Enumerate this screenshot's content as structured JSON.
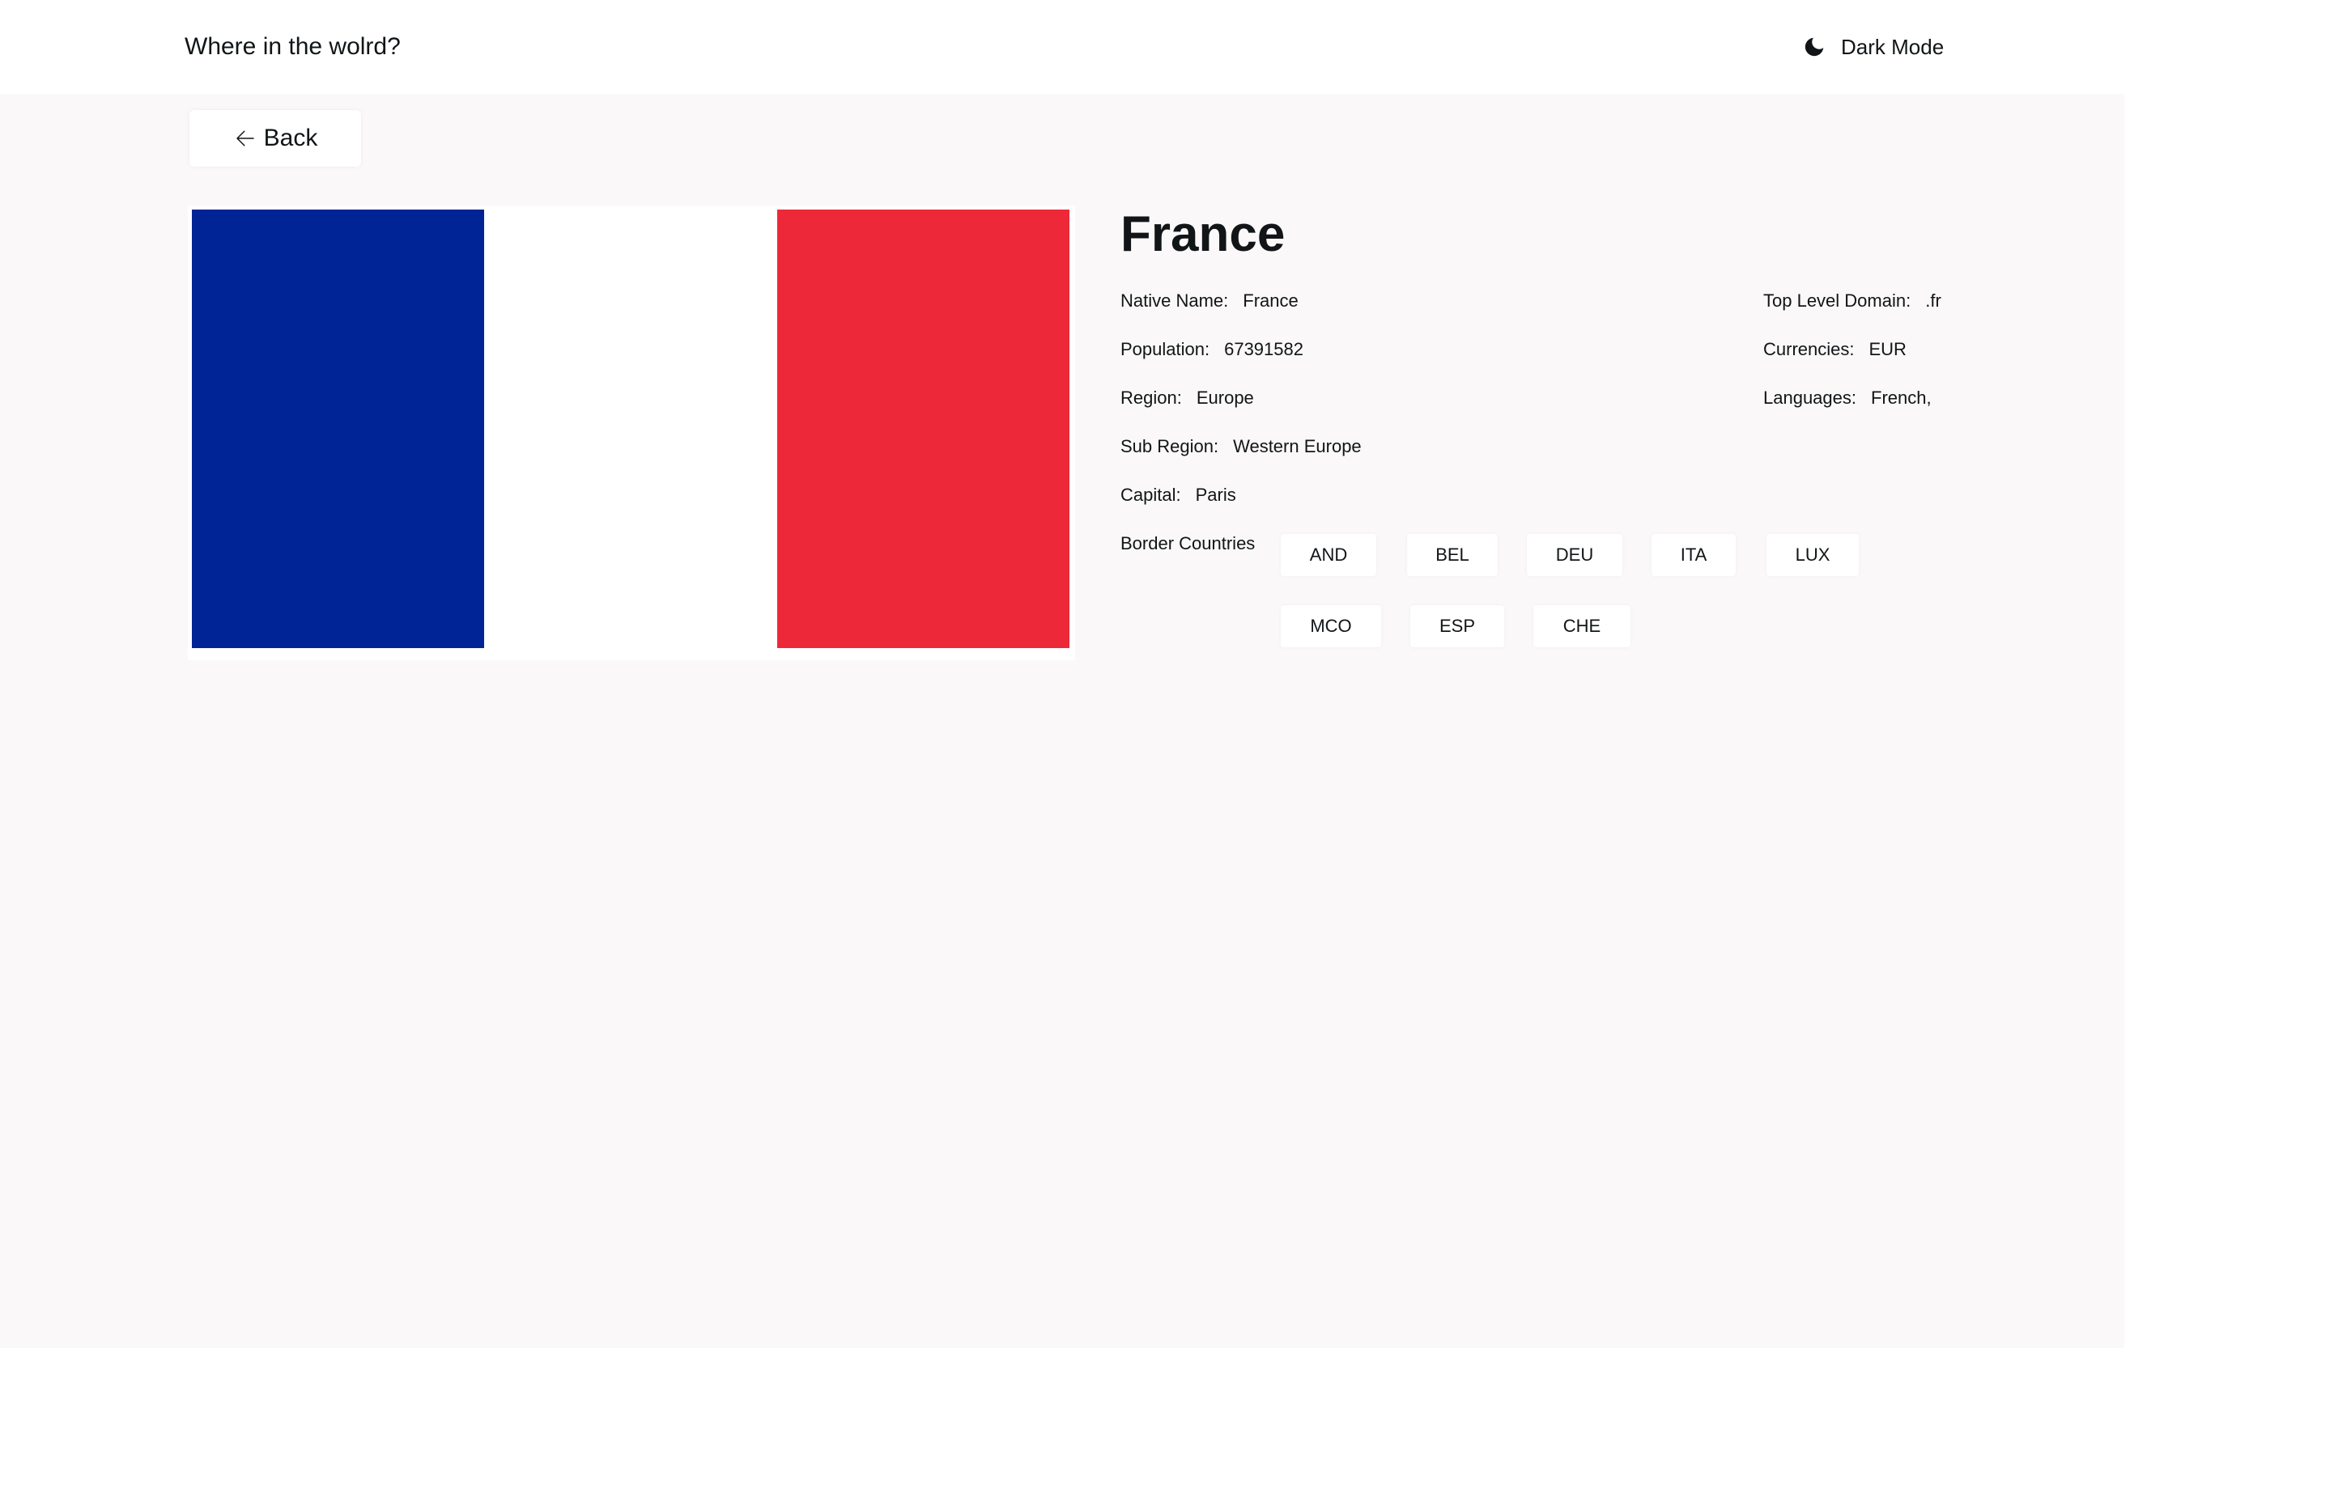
{
  "header": {
    "title": "Where in the wolrd?",
    "dark_mode_label": "Dark Mode",
    "dark_mode_icon": "moon-icon"
  },
  "back": {
    "label": "Back",
    "icon": "arrow-left-icon"
  },
  "flag": {
    "country": "France",
    "colors": [
      "#002395",
      "#ffffff",
      "#ed2939"
    ]
  },
  "country": {
    "name": "France",
    "native_name_label": "Native Name:",
    "native_name": "France",
    "population_label": "Population:",
    "population": "67391582",
    "region_label": "Region:",
    "region": "Europe",
    "sub_region_label": "Sub Region:",
    "sub_region": "Western Europe",
    "capital_label": "Capital:",
    "capital": "Paris",
    "tld_label": "Top Level Domain:",
    "tld": ".fr",
    "currencies_label": "Currencies:",
    "currencies": "EUR",
    "languages_label": "Languages:",
    "languages": "French,"
  },
  "borders": {
    "label": "Border Countries",
    "countries": [
      "AND",
      "BEL",
      "DEU",
      "ITA",
      "LUX",
      "MCO",
      "ESP",
      "CHE"
    ]
  },
  "colors": {
    "background": "#faf8f8",
    "element": "#ffffff",
    "text": "#111517"
  }
}
